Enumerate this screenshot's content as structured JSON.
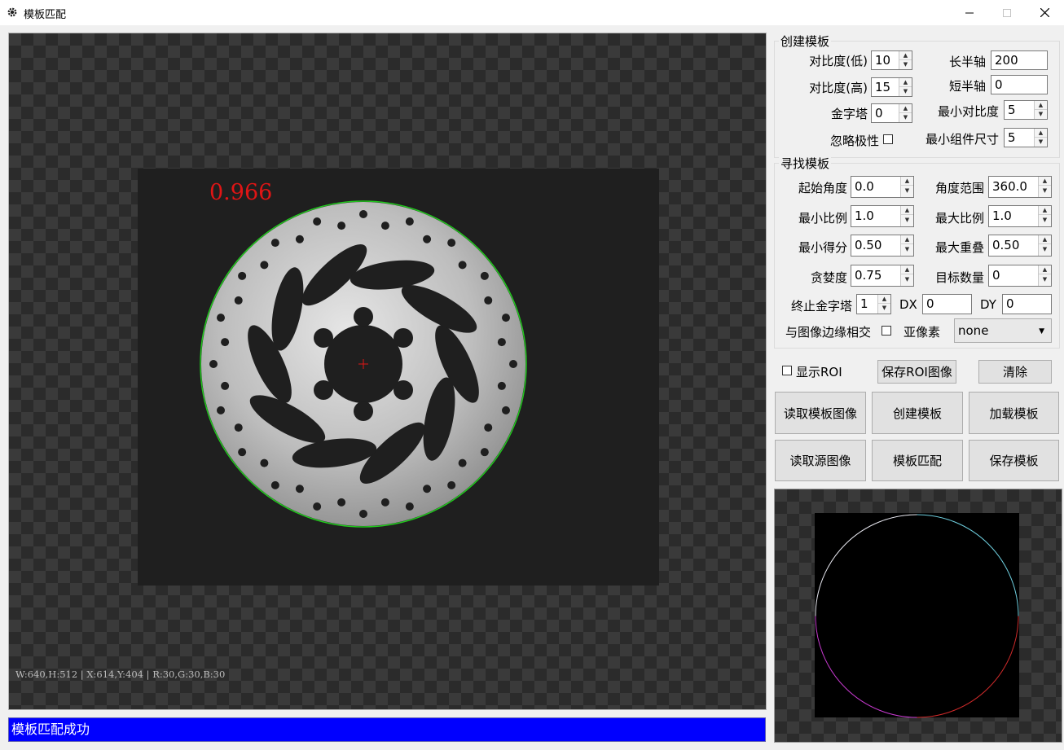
{
  "window": {
    "title": "模板匹配",
    "minimize_icon": "minimize-icon",
    "maximize_icon": "maximize-icon",
    "close_icon": "close-icon"
  },
  "main_view": {
    "score": "0.966",
    "pixel_info": "W:640,H:512 | X:614,Y:404 | R:30,G:30,B:30"
  },
  "status_bar": {
    "text": "模板匹配成功",
    "background": "#0000ff"
  },
  "create_group": {
    "title": "创建模板",
    "contrast_low": {
      "label": "对比度(低)",
      "value": "10"
    },
    "contrast_high": {
      "label": "对比度(高)",
      "value": "15"
    },
    "pyramid": {
      "label": "金字塔",
      "value": "0"
    },
    "ignore_polarity": {
      "label": "忽略极性"
    },
    "long_axis": {
      "label": "长半轴",
      "value": "200"
    },
    "short_axis": {
      "label": "短半轴",
      "value": "0"
    },
    "min_contrast": {
      "label": "最小对比度",
      "value": "5"
    },
    "min_component_size": {
      "label": "最小组件尺寸",
      "value": "5"
    }
  },
  "find_group": {
    "title": "寻找模板",
    "start_angle": {
      "label": "起始角度",
      "value": "0.0"
    },
    "angle_range": {
      "label": "角度范围",
      "value": "360.0"
    },
    "min_scale": {
      "label": "最小比例",
      "value": "1.0"
    },
    "max_scale": {
      "label": "最大比例",
      "value": "1.0"
    },
    "min_score": {
      "label": "最小得分",
      "value": "0.50"
    },
    "max_overlap": {
      "label": "最大重叠",
      "value": "0.50"
    },
    "greediness": {
      "label": "贪婪度",
      "value": "0.75"
    },
    "num_targets": {
      "label": "目标数量",
      "value": "0"
    },
    "stop_pyramid": {
      "label": "终止金字塔",
      "value": "1"
    },
    "dx": {
      "label": "DX",
      "value": "0"
    },
    "dy": {
      "label": "DY",
      "value": "0"
    },
    "border_intersect": {
      "label": "与图像边缘相交"
    },
    "subpixel": {
      "label": "亚像素",
      "value": "none"
    }
  },
  "roi": {
    "show_label": "显示ROI",
    "save_button": "保存ROI图像",
    "clear_button": "清除"
  },
  "actions": {
    "read_template_image": "读取模板图像",
    "create_template": "创建模板",
    "load_template": "加载模板",
    "read_source_image": "读取源图像",
    "template_match": "模板匹配",
    "save_template": "保存模板"
  },
  "colors": {
    "match_contour": "#22c81e",
    "score_text": "#e01515",
    "center_mark": "#e01515"
  }
}
